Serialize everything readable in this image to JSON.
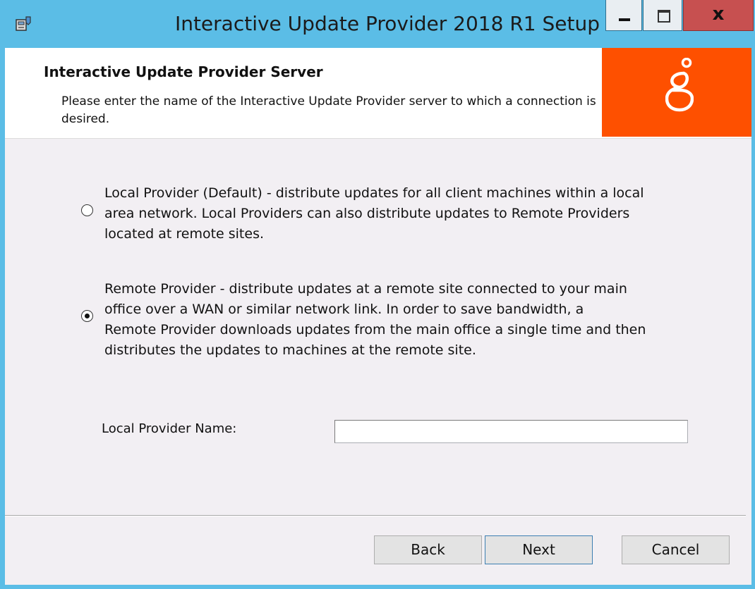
{
  "window": {
    "title": "Interactive Update Provider 2018 R1 Setup",
    "controls": {
      "minimize": "minimize",
      "maximize": "maximize",
      "close": "x"
    }
  },
  "banner": {
    "title": "Interactive Update Provider Server",
    "description": "Please enter the name of the Interactive Update Provider server to which a connection is desired.",
    "logo_color": "#fe5000"
  },
  "options": [
    {
      "label": "Local Provider (Default) - distribute updates for all client machines within a local\narea network.  Local Providers can also distribute updates to Remote Providers\nlocated at remote sites.",
      "selected": false
    },
    {
      "label": "Remote Provider - distribute updates at a remote site connected to your main\noffice over a WAN or similar network link.  In order to save bandwidth, a\nRemote Provider downloads updates from the main office a single time and then\ndistributes the updates to machines at the remote site.",
      "selected": true
    }
  ],
  "field": {
    "label": "Local Provider Name:",
    "value": ""
  },
  "buttons": {
    "back": "Back",
    "next": "Next",
    "cancel": "Cancel"
  }
}
